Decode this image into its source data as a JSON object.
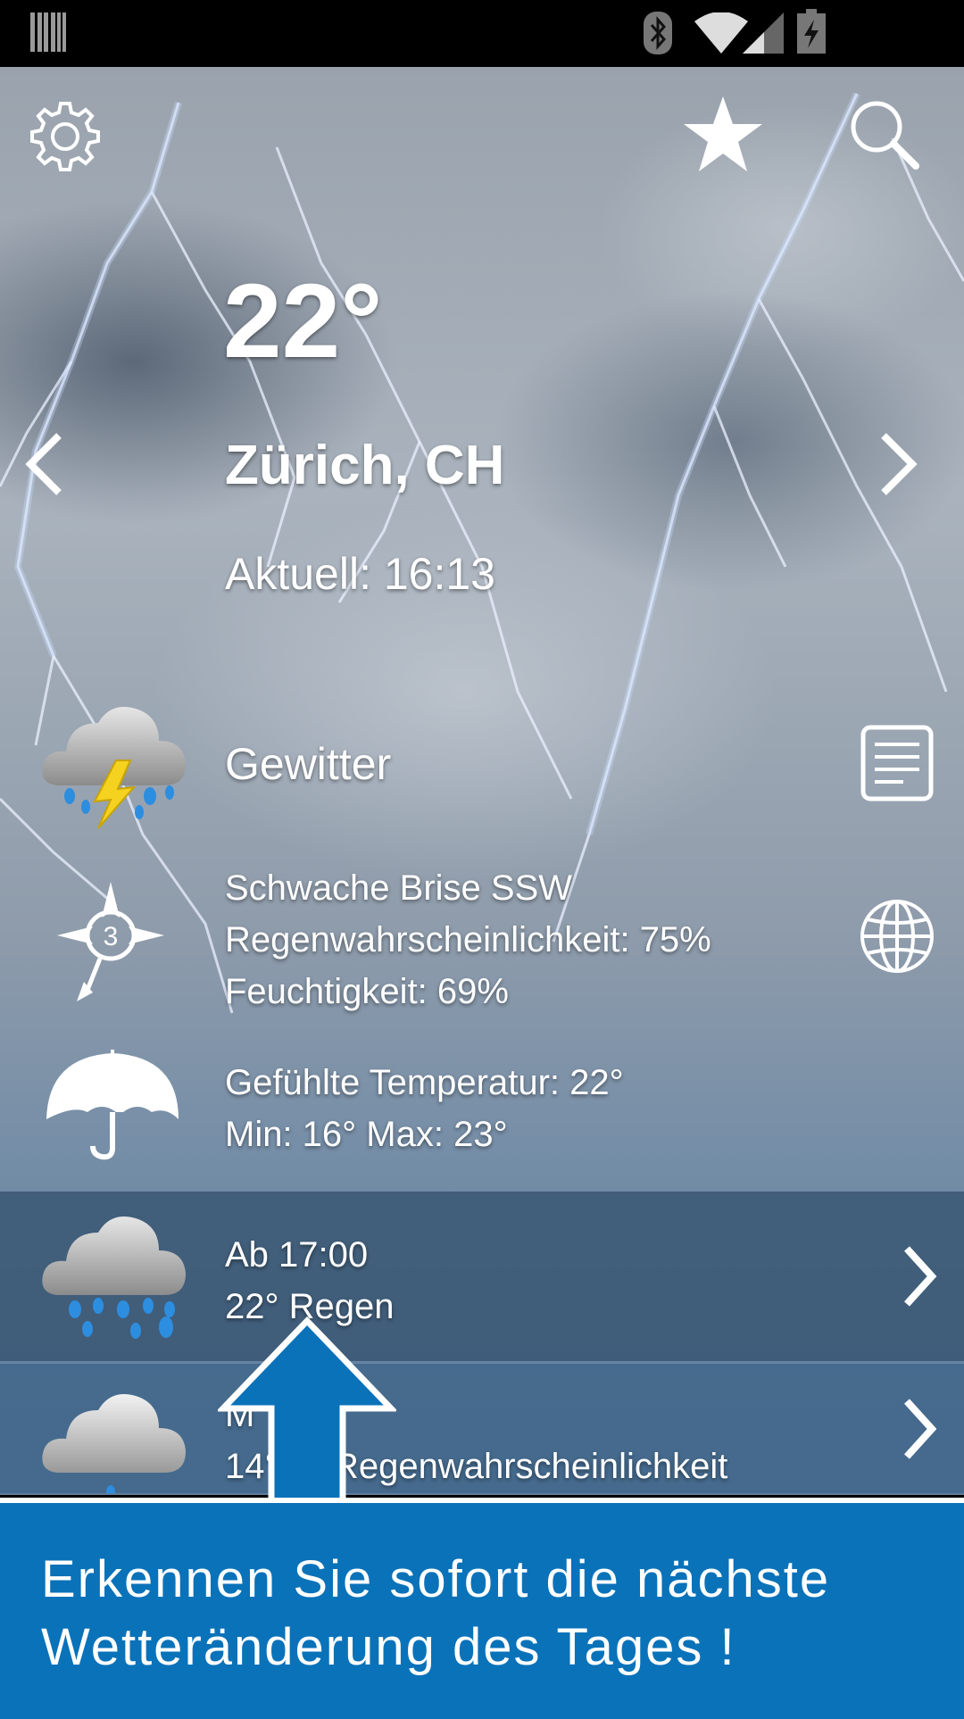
{
  "status_bar": {
    "icons": [
      "barcode-icon",
      "bluetooth-icon",
      "wifi-icon",
      "signal-icon",
      "battery-charging-icon"
    ]
  },
  "toolbar": {
    "settings_icon": "gear-icon",
    "favorite_icon": "star-icon",
    "search_icon": "search-icon"
  },
  "current": {
    "temperature": "22°",
    "location": "Zürich, CH",
    "updated": "Aktuell: 16:13",
    "condition": "Gewitter",
    "wind": "Schwache Brise SSW",
    "wind_force": "3",
    "rain_probability": "Regenwahrscheinlichkeit: 75%",
    "humidity": "Feuchtigkeit: 69%",
    "feels_like": "Gefühlte Temperatur: 22°",
    "min_max": "Min: 16° Max: 23°"
  },
  "forecast": [
    {
      "line1": "Ab 17:00",
      "line2": "22° Regen",
      "icon": "rain-cloud-icon"
    },
    {
      "line1": "M",
      "line2": "14° 8° Regenwahrscheinlichkeit",
      "icon": "cloud-icon"
    }
  ],
  "banner": {
    "text_line1": "Erkennen Sie sofort die nächste",
    "text_line2": "Wetteränderung des Tages !"
  },
  "colors": {
    "banner_blue": "#0a72b9",
    "forecast_band": "#46617b",
    "forecast_band2": "#4f6c89"
  }
}
